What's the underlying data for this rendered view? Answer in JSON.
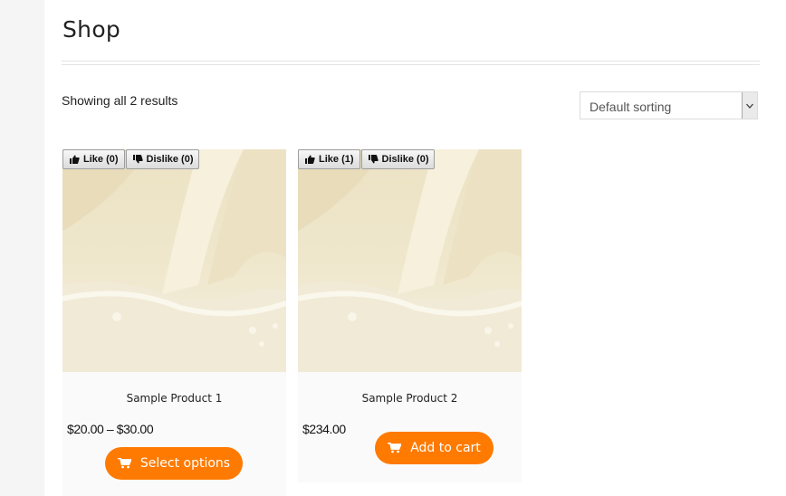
{
  "page": {
    "title": "Shop"
  },
  "results_text": "Showing all 2 results",
  "sorting": {
    "selected": "Default sorting"
  },
  "products": [
    {
      "name": "Sample Product 1",
      "price": "$20.00 – $30.00",
      "like_label": "Like (0)",
      "dislike_label": "Dislike (0)",
      "button_label": "Select options"
    },
    {
      "name": "Sample Product 2",
      "price": "$234.00",
      "like_label": "Like (1)",
      "dislike_label": "Dislike (0)",
      "button_label": "Add to cart"
    }
  ],
  "colors": {
    "accent": "#ff7a00",
    "card_bg": "#fafafa"
  },
  "icons": {
    "like": "thumbs-up-icon",
    "dislike": "thumbs-down-icon",
    "cart": "cart-icon",
    "select": "chevron-down-icon"
  }
}
